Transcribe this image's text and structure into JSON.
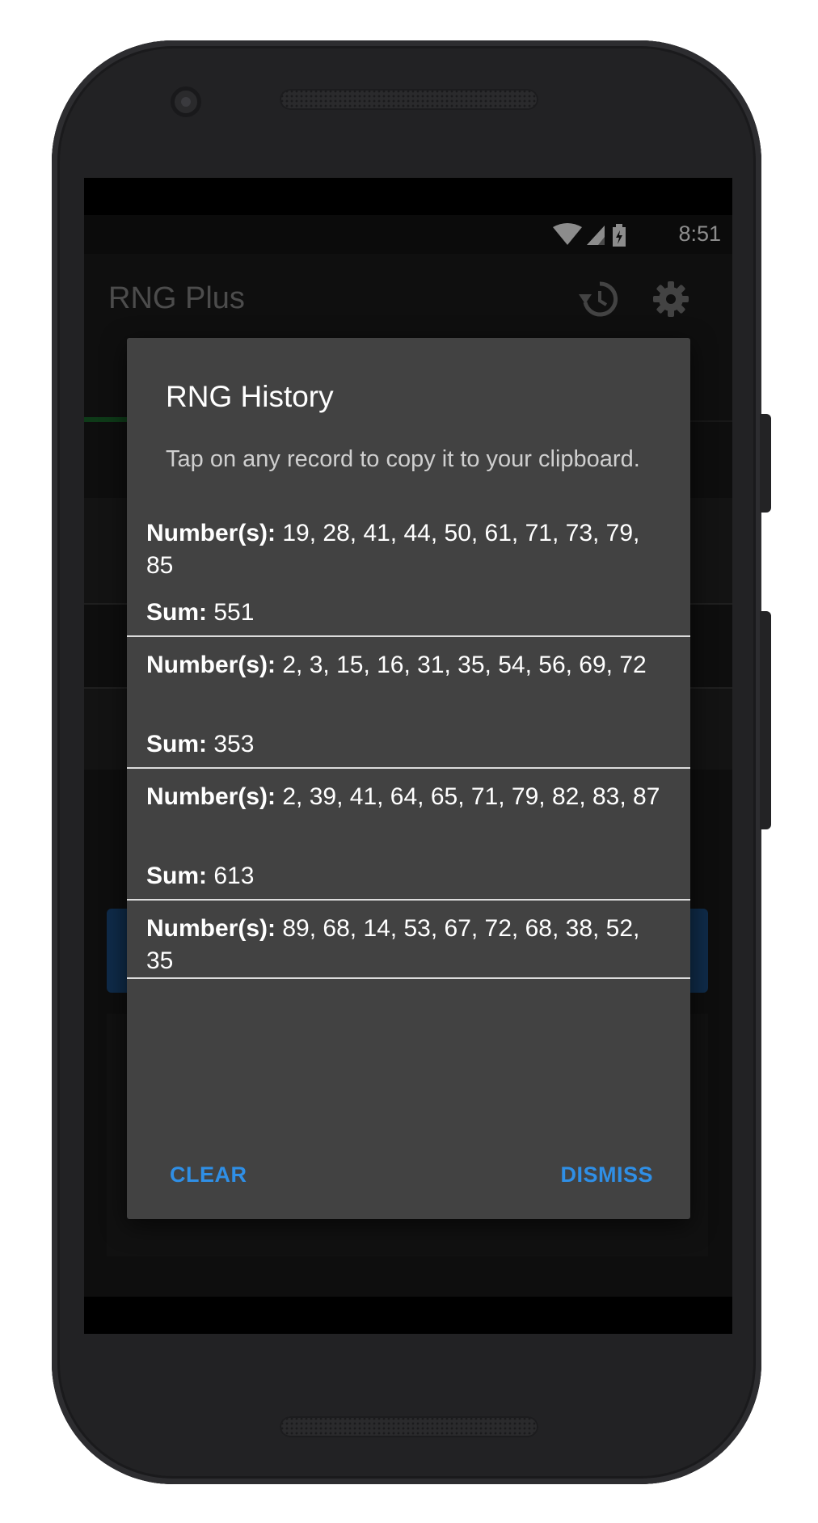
{
  "status_bar": {
    "time": "8:51",
    "icons": [
      "wifi-icon",
      "cell-signal-icon",
      "battery-charging-icon"
    ]
  },
  "app": {
    "title": "RNG Plus",
    "toolbar_icons": [
      "history-icon",
      "settings-gear-icon"
    ],
    "accent_color": "#1c4f86",
    "tab_indicator_color": "#1b6b2c"
  },
  "dialog": {
    "title": "RNG History",
    "message": "Tap on any record to copy it to your clipboard.",
    "records": [
      {
        "numbers_label": "Number(s):",
        "numbers": "19, 28, 41, 44, 50, 61, 71, 73, 79, 85",
        "sum_label": "Sum:",
        "sum": "551"
      },
      {
        "numbers_label": "Number(s):",
        "numbers": "2, 3, 15, 16, 31, 35, 54, 56, 69, 72",
        "sum_label": "Sum:",
        "sum": "353"
      },
      {
        "numbers_label": "Number(s):",
        "numbers": "2, 39, 41, 64, 65, 71, 79, 82, 83, 87",
        "sum_label": "Sum:",
        "sum": "613"
      },
      {
        "numbers_label": "Number(s):",
        "numbers": "89, 68, 14, 53, 67, 72, 68, 38, 52, 35"
      }
    ],
    "clear_label": "CLEAR",
    "dismiss_label": "DISMISS",
    "button_color": "#2f8fe6",
    "background_color": "#424242"
  }
}
